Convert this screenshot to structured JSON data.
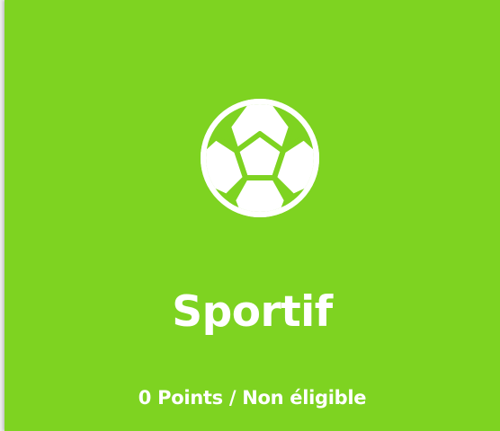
{
  "card": {
    "background_color": "#7ed321",
    "icon": "soccer-ball-icon",
    "title": "Sportif",
    "status": "0 Points / Non éligible"
  }
}
